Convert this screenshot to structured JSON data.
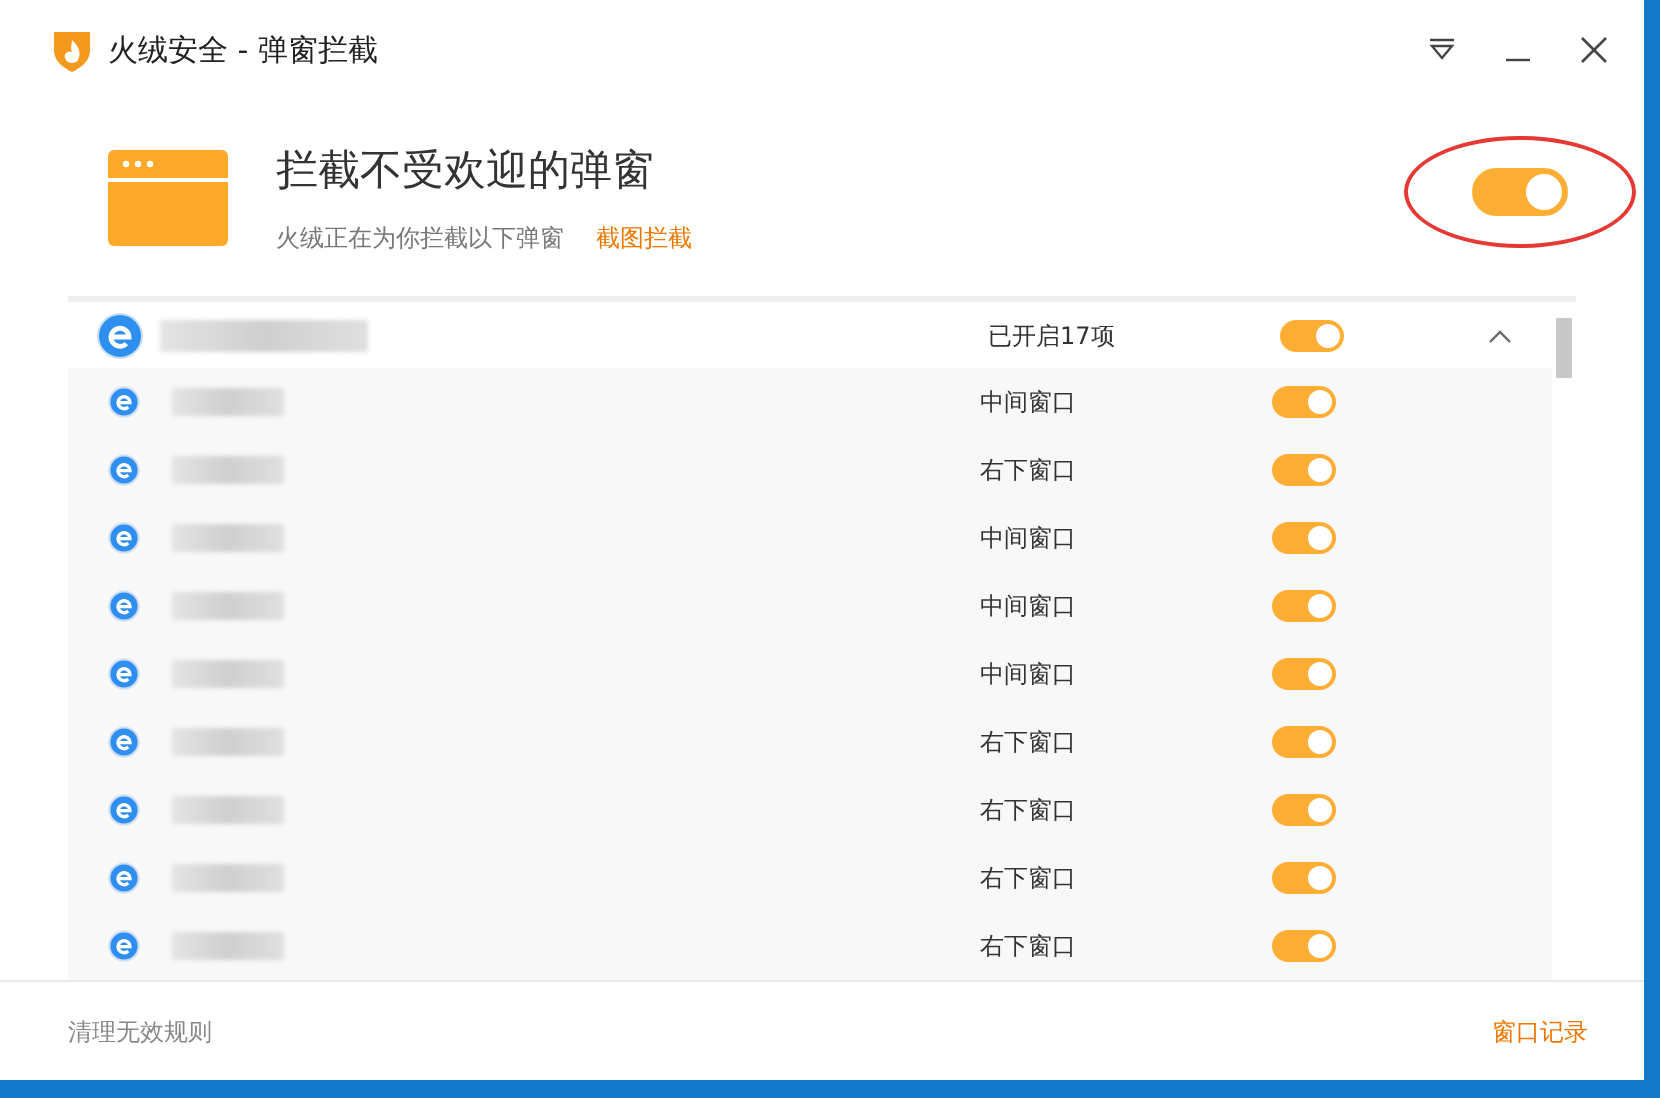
{
  "window": {
    "title": "火绒安全 - 弹窗拦截"
  },
  "header": {
    "heading": "拦截不受欢迎的弹窗",
    "subtitle": "火绒正在为你拦截以下弹窗",
    "link": "截图拦截",
    "on": true,
    "circled": true
  },
  "group": {
    "count": "已开启17项",
    "on": true,
    "expanded": true
  },
  "rules": [
    {
      "position": "中间窗口",
      "on": true
    },
    {
      "position": "右下窗口",
      "on": true
    },
    {
      "position": "中间窗口",
      "on": true
    },
    {
      "position": "中间窗口",
      "on": true
    },
    {
      "position": "中间窗口",
      "on": true
    },
    {
      "position": "右下窗口",
      "on": true
    },
    {
      "position": "右下窗口",
      "on": true
    },
    {
      "position": "右下窗口",
      "on": true
    },
    {
      "position": "右下窗口",
      "on": true
    }
  ],
  "footer": {
    "left": "清理无效规则",
    "right": "窗口记录"
  }
}
